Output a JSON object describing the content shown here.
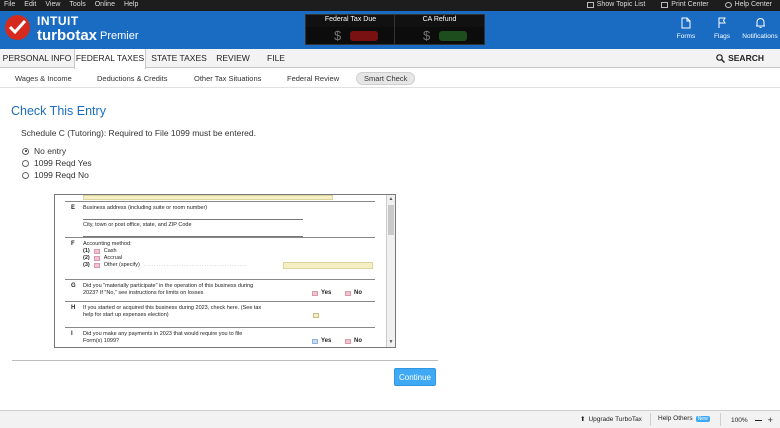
{
  "menubar": {
    "items": [
      "File",
      "Edit",
      "View",
      "Tools",
      "Online",
      "Help"
    ],
    "right": [
      "Show Topic List",
      "Print Center",
      "Help Center"
    ]
  },
  "brand": {
    "company": "INTUIT",
    "product": "turbotax",
    "edition": "Premier"
  },
  "refund_boxes": {
    "federal_label": "Federal Tax Due",
    "federal_amount": "$",
    "ca_label": "CA Refund",
    "ca_amount": "$"
  },
  "header_icons": [
    "Forms",
    "Flags",
    "Notifications"
  ],
  "tabs": [
    "PERSONAL INFO",
    "FEDERAL TAXES",
    "STATE TAXES",
    "REVIEW",
    "FILE"
  ],
  "active_tab": "FEDERAL TAXES",
  "search_label": "SEARCH",
  "subtabs": [
    "Wages & Income",
    "Deductions & Credits",
    "Other Tax Situations",
    "Federal Review",
    "Smart Check"
  ],
  "active_subtab": "Smart Check",
  "page": {
    "title": "Check This Entry",
    "description": "Schedule C (Tutoring): Required to File 1099 must be entered.",
    "options": [
      "No entry",
      "1099 Reqd Yes",
      "1099 Reqd No"
    ],
    "selected_option": "No entry"
  },
  "form": {
    "E_letter": "E",
    "E_text": "Business address (including suite or room number)",
    "E_sub": "City, town or post office, state, and ZIP Code",
    "F_letter": "F",
    "F_text": "Accounting method:",
    "F_options": [
      {
        "num": "(1)",
        "label": "Cash"
      },
      {
        "num": "(2)",
        "label": "Accrual"
      },
      {
        "num": "(3)",
        "label": "Other (specify)"
      }
    ],
    "G_letter": "G",
    "G_line1": "Did you \"materially participate\" in the operation of this business during",
    "G_line2": "2023? If \"No,\" see instructions for limits on losses",
    "H_letter": "H",
    "H_line1": "If you started or acquired this business during 2023, check here. (See tax",
    "H_line2": "help for start up expenses election)",
    "I_letter": "I",
    "I_line1": "Did you make any payments in 2023 that would require you to file",
    "I_line2": "Form(s) 1099?",
    "yes": "Yes",
    "no": "No"
  },
  "continue_label": "Continue",
  "bottombar": {
    "upgrade": "Upgrade TurboTax",
    "help_others": "Help Others",
    "new_badge": "New",
    "zoom": "100%"
  },
  "colors": {
    "header_blue": "#1a6cc2",
    "accent_button": "#3fa9f5",
    "logo_red": "#d52b1e",
    "title_blue": "#1a6cc2"
  }
}
